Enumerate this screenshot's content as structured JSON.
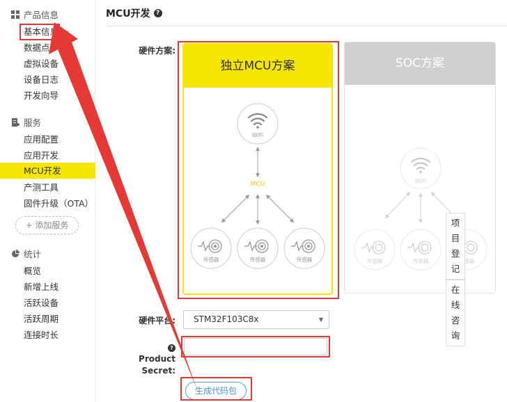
{
  "sidebar": {
    "sections": [
      {
        "title": "产品信息",
        "icon": "grid-icon",
        "items": [
          "基本信息",
          "数据点",
          "虚拟设备",
          "设备日志",
          "开发向导"
        ]
      },
      {
        "title": "服务",
        "icon": "document-icon",
        "items": [
          "应用配置",
          "应用开发",
          "MCU开发",
          "产测工具",
          "固件升级（OTA）"
        ]
      },
      {
        "title": "统计",
        "icon": "pie-chart-icon",
        "items": [
          "概览",
          "新增上线",
          "活跃设备",
          "活跃周期",
          "连接时长"
        ]
      }
    ],
    "add_service": "+ 添加服务",
    "active_item": "MCU开发"
  },
  "main": {
    "title": "MCU开发",
    "hardware_scheme_label": "硬件方案:",
    "mcu_card": {
      "title": "独立MCU方案",
      "wifi": "WiFi",
      "mcu": "MCU",
      "sensor": "传感器"
    },
    "soc_card": {
      "title": "SOC方案",
      "wifi": "WiFi",
      "sensor": "传感器"
    },
    "platform_label": "硬件平台:",
    "platform_value": "STM32F103C8x",
    "product_secret_label_1": "Product",
    "product_secret_label_2": "Secret:",
    "product_secret_value": "",
    "generate_button": "生成代码包"
  },
  "floating": {
    "register_chars": [
      "项",
      "目",
      "登",
      "记"
    ],
    "consult_chars": [
      "在",
      "线",
      "咨",
      "询"
    ]
  },
  "colors": {
    "accent": "#f7e600",
    "annotation": "#e53935",
    "link": "#4a90c8"
  }
}
